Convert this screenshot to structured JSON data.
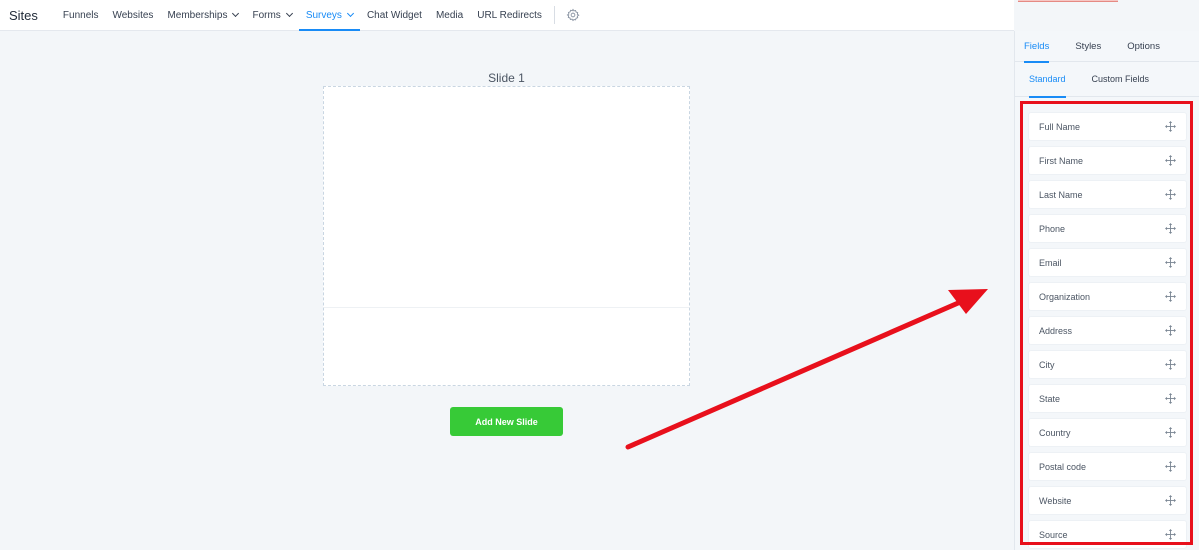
{
  "nav": {
    "brand": "Sites",
    "items": [
      {
        "label": "Funnels",
        "dropdown": false,
        "active": false
      },
      {
        "label": "Websites",
        "dropdown": false,
        "active": false
      },
      {
        "label": "Memberships",
        "dropdown": true,
        "active": false
      },
      {
        "label": "Forms",
        "dropdown": true,
        "active": false
      },
      {
        "label": "Surveys",
        "dropdown": true,
        "active": true
      },
      {
        "label": "Chat Widget",
        "dropdown": false,
        "active": false
      },
      {
        "label": "Media",
        "dropdown": false,
        "active": false
      },
      {
        "label": "URL Redirects",
        "dropdown": false,
        "active": false
      }
    ],
    "settings_icon": "gear-icon"
  },
  "canvas": {
    "slide_title": "Slide 1",
    "add_slide_label": "Add New Slide"
  },
  "panel": {
    "tabs": [
      {
        "label": "Fields",
        "active": true
      },
      {
        "label": "Styles",
        "active": false
      },
      {
        "label": "Options",
        "active": false
      }
    ],
    "subtabs": [
      {
        "label": "Standard",
        "active": true
      },
      {
        "label": "Custom Fields",
        "active": false
      }
    ],
    "fields": [
      "Full Name",
      "First Name",
      "Last Name",
      "Phone",
      "Email",
      "Organization",
      "Address",
      "City",
      "State",
      "Country",
      "Postal code",
      "Website",
      "Source"
    ],
    "drag_icon": "move-icon"
  },
  "colors": {
    "accent": "#188bf6",
    "button_green": "#37ca37",
    "annotation_red": "#e8101c"
  }
}
